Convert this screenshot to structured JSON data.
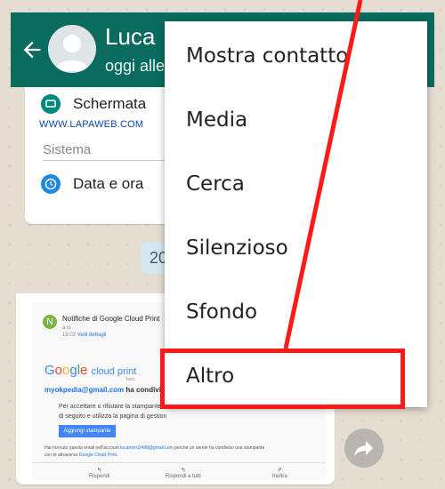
{
  "header": {
    "contact_name": "Luca",
    "status": "oggi alle"
  },
  "settings_bubble": {
    "row1_label": "Schermata",
    "watermark": "WWW.LAPAWEB.COM",
    "section_title": "Sistema",
    "row2_label": "Data e ora"
  },
  "date_chip": "20",
  "email": {
    "avatar_letter": "N",
    "subject": "Notifiche di Google Cloud Print",
    "to": "a io",
    "time": "18:03",
    "details_link": "Vedi dettagli",
    "logo_brand": "Google",
    "logo_product": "cloud print",
    "logo_beta": "beta",
    "shared_email": "myokpedia@gmail.com",
    "shared_text": "ha condivis",
    "body_line1": "Per accettare o rifiutare la stampante h",
    "body_line2": "di seguito e utilizza la pagina di gestion",
    "button_label": "Aggiungi stampante",
    "footer_pre": "Hai ricevuto questa email nell'account",
    "footer_email": "lucamirro2498@gmail.com",
    "footer_post": "perché un utente ha condiviso una stampante",
    "footer_line2_pre": "con te attraverso",
    "footer_link": "Google Cloud Print",
    "action_reply": "Rispondi",
    "action_reply_all": "Rispondi a tutti",
    "action_forward": "Inoltra"
  },
  "menu": {
    "items": [
      {
        "label": "Mostra contatto"
      },
      {
        "label": "Media"
      },
      {
        "label": "Cerca"
      },
      {
        "label": "Silenzioso"
      },
      {
        "label": "Sfondo"
      },
      {
        "label": "Altro"
      }
    ]
  },
  "colors": {
    "header": "#0a6c5e",
    "annotation": "#ff1a1a"
  }
}
